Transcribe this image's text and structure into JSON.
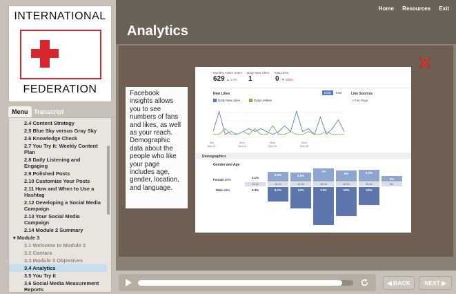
{
  "logo": {
    "line1": "INTERNATIONAL",
    "line2": "FEDERATION",
    "color": "#d8262e"
  },
  "tabs": {
    "menu": "Menu",
    "transcript": "Transcript"
  },
  "menu_items": [
    {
      "label": "2.4 Content Strategy",
      "type": "item",
      "state": "normal"
    },
    {
      "label": "2.5 Blue Sky versus Gray Sky",
      "type": "item",
      "state": "normal"
    },
    {
      "label": "2.6 Knowledge Check",
      "type": "item",
      "state": "normal"
    },
    {
      "label": "2.7 You Try It: Weekly Content Plan",
      "type": "item",
      "state": "normal"
    },
    {
      "label": "2.8 Daily Listening and Engaging",
      "type": "item",
      "state": "normal"
    },
    {
      "label": "2.9 Polished Posts",
      "type": "item",
      "state": "normal"
    },
    {
      "label": "2.10 Customize Your Posts",
      "type": "item",
      "state": "normal"
    },
    {
      "label": "2.11 How and When to Use a Hashtag",
      "type": "item",
      "state": "normal"
    },
    {
      "label": "2.12 Developing a Social Media Campaign",
      "type": "item",
      "state": "normal"
    },
    {
      "label": "2.13 Your Social Media Campaign",
      "type": "item",
      "state": "normal"
    },
    {
      "label": "2.14 Module 2 Summary",
      "type": "item",
      "state": "normal"
    },
    {
      "label": "▾  Module 3",
      "type": "section",
      "state": "normal"
    },
    {
      "label": "3.1 Welcome to Module 3",
      "type": "item",
      "state": "visited"
    },
    {
      "label": "3.2 Cantara",
      "type": "item",
      "state": "visited"
    },
    {
      "label": "3.3 Module 3 Objectives",
      "type": "item",
      "state": "visited"
    },
    {
      "label": "3.4 Analytics",
      "type": "item",
      "state": "active"
    },
    {
      "label": "3.5 You Try It",
      "type": "item",
      "state": "normal"
    },
    {
      "label": "3.6 Social Media Measurement Reports",
      "type": "item",
      "state": "normal"
    }
  ],
  "topnav": {
    "home": "Home",
    "resources": "Resources",
    "exit": "Exit"
  },
  "page_title": "Analytics",
  "callout": "Facebook insights allows you to see numbers of fans and likes, as well as your reach. Demographic data about the people who like your page includes age, gender, location, and language.",
  "insights": {
    "stats": [
      {
        "label": "Monthly Active Users",
        "value": "629",
        "change": "▲ 1.4%",
        "dir": "up"
      },
      {
        "label": "Daily New Likes",
        "value": "1",
        "change": "",
        "dir": ""
      },
      {
        "label": "Total Likes",
        "value": "0",
        "change": "▼ 100%",
        "dir": "down"
      }
    ],
    "new_likes_title": "New Likes",
    "legend": {
      "daily_new_likes": "Daily New Likes",
      "daily_unlikes": "Daily Unlikes"
    },
    "view_buttons": {
      "daily": "Daily",
      "total": "Total"
    },
    "like_sources": {
      "title": "Like Sources",
      "item": "Fan Page"
    },
    "x_ticks": [
      "Sun\nNov 11",
      "Mon\nNov 12",
      "Mon\nNov 19",
      "Mon\nNov 26"
    ],
    "demographics_title": "Demographics",
    "gender_age_title": "Gender and Age",
    "female": {
      "label": "Female",
      "pct": "25%"
    },
    "male": {
      "label": "Male",
      "pct": "69%"
    },
    "age_groups": [
      "13-17",
      "18-24",
      "25-34",
      "35-44",
      "45-54",
      "55-64",
      "65+"
    ]
  },
  "chart_data": {
    "type": "bar",
    "title": "Gender and Age",
    "categories": [
      "13-17",
      "18-24",
      "25-34",
      "35-44",
      "45-54",
      "55-64",
      "65+"
    ],
    "series": [
      {
        "name": "Female",
        "values": [
          3.1,
          5.2,
          4.9,
          7.0,
          6.0,
          6.2,
          3.0
        ]
      },
      {
        "name": "Male",
        "values": [
          3.3,
          8.1,
          12.0,
          21.0,
          16.0,
          10.0,
          0
        ]
      }
    ],
    "labels_female": [
      "3.1%",
      "5.2%",
      "4.9%",
      "7%",
      "6%",
      "6.2%",
      "3%"
    ],
    "labels_male": [
      "3.3%",
      "8.1%",
      "12%",
      "21%",
      "16%",
      "10%",
      ""
    ],
    "line_chart": {
      "type": "line",
      "title": "New Likes",
      "series": [
        {
          "name": "Daily New Likes",
          "values": [
            0.2,
            0.9,
            0.1,
            0.2,
            0.1,
            0.2,
            0.3,
            0.2,
            0.3,
            0.2,
            0.1,
            0.2,
            0.4,
            0.2,
            0.9,
            0.2,
            0.3,
            0.1,
            0.7,
            0.1,
            0.3,
            0.6,
            0.2
          ]
        },
        {
          "name": "Daily Unlikes",
          "values": [
            0.1,
            0.1,
            0.3,
            0.1,
            0.1,
            0.2,
            0.1,
            0.3,
            0.1,
            0.1,
            0.4,
            0.1,
            0.1,
            0.2,
            0.1,
            0.1,
            0.2,
            0.1,
            0.1,
            0.2,
            0.1,
            0.1,
            0.1
          ]
        }
      ]
    }
  },
  "player": {
    "progress": 0.95
  },
  "nav": {
    "back": "◀ BACK",
    "next": "NEXT ▶"
  }
}
